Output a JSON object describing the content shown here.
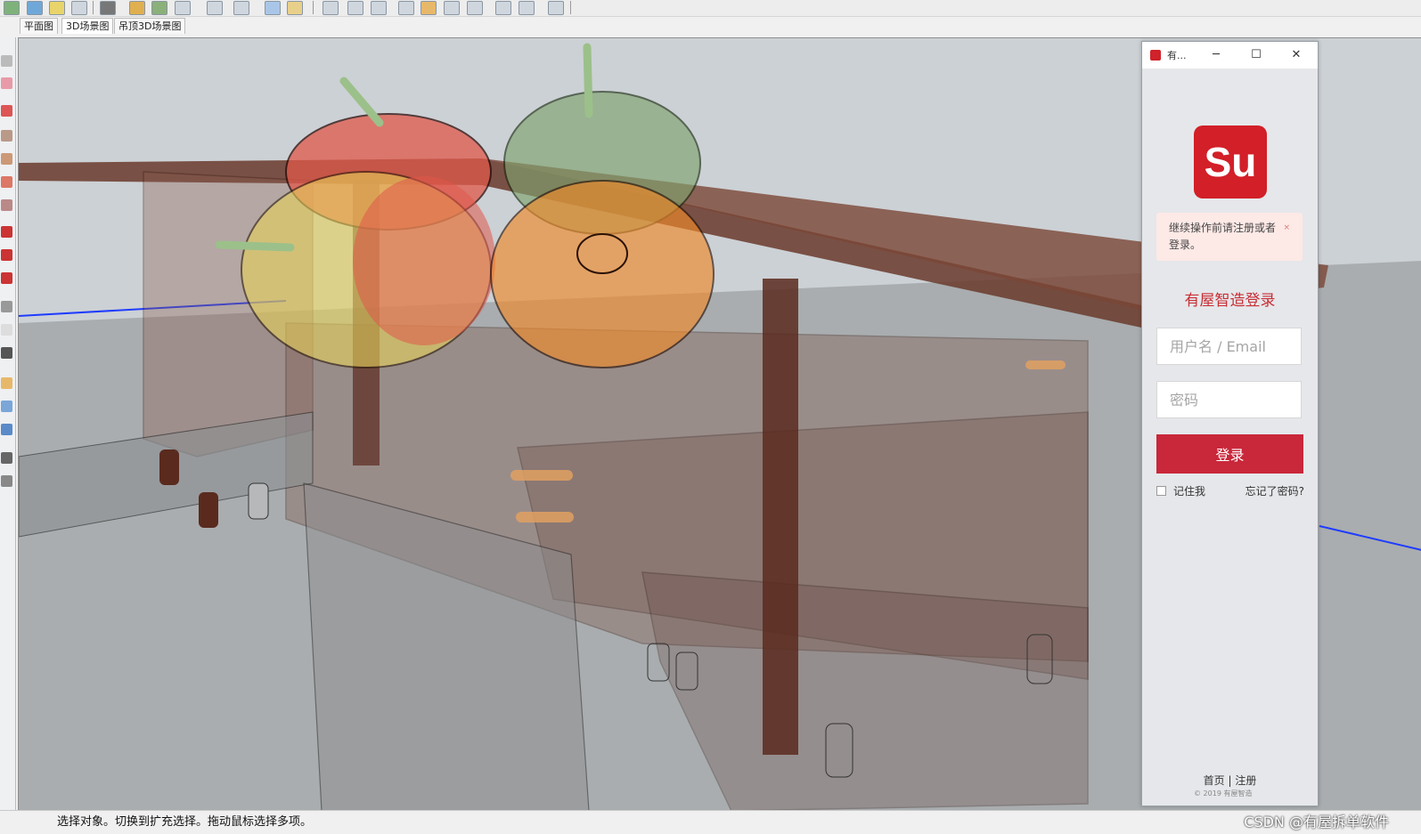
{
  "tabs": [
    {
      "label": "平面图",
      "active": false
    },
    {
      "label": "3D场景图",
      "active": true
    },
    {
      "label": "吊顶3D场景图",
      "active": false
    }
  ],
  "statusbar": {
    "text": "选择对象。切换到扩充选择。拖动鼠标选择多项。",
    "watermark": "CSDN @有屋拆单软件"
  },
  "login": {
    "window_title": "有...",
    "controls": {
      "minimize": "─",
      "maximize": "☐",
      "close": "✕"
    },
    "logo_text": "Su",
    "notice": "继续操作前请注册或者登录。",
    "notice_close": "×",
    "heading": "有屋智造登录",
    "username_placeholder": "用户名 / Email",
    "password_placeholder": "密码",
    "login_button": "登录",
    "remember_me": "记住我",
    "forgot_password": "忘记了密码?",
    "footer_links": "首页 | 注册",
    "copyright": "© 2019 有屋智造"
  },
  "colors": {
    "accent": "#c9273a",
    "logo_red": "#d21f28",
    "notice_bg": "#fde9e6",
    "wood": "#5a2a1e"
  }
}
